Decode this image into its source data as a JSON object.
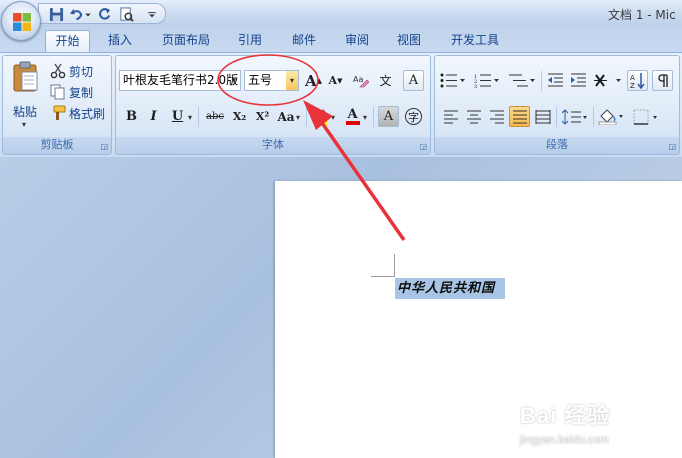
{
  "window": {
    "title": "文档 1 - Mic"
  },
  "tabs": [
    {
      "label": "开始",
      "active": true
    },
    {
      "label": "插入"
    },
    {
      "label": "页面布局"
    },
    {
      "label": "引用"
    },
    {
      "label": "邮件"
    },
    {
      "label": "审阅"
    },
    {
      "label": "视图"
    },
    {
      "label": "开发工具"
    }
  ],
  "clipboard": {
    "paste_label": "粘贴",
    "cut_label": "剪切",
    "copy_label": "复制",
    "format_painter_label": "格式刷",
    "group_label": "剪贴板"
  },
  "font": {
    "family_value": "叶根友毛笔行书2.0版",
    "size_value": "五号",
    "group_label": "字体",
    "bold": "B",
    "italic": "I",
    "underline": "U",
    "strikethrough": "abc",
    "subscript": "X₂",
    "superscript": "X²",
    "change_case": "Aa",
    "grow_font": "A",
    "shrink_font": "A",
    "text_effect": "A",
    "char_border": "A",
    "phonetic": "文",
    "enclose": "字",
    "font_color": "A",
    "highlight_color": "#ffff00",
    "font_color_swatch": "#e00000"
  },
  "paragraph": {
    "group_label": "段落"
  },
  "document": {
    "selected_text": "中华人民共和国"
  },
  "annotation": {
    "color": "#e8333a"
  },
  "watermark": {
    "brand": "Bai 经验",
    "url": "jingyan.baidu.com"
  }
}
